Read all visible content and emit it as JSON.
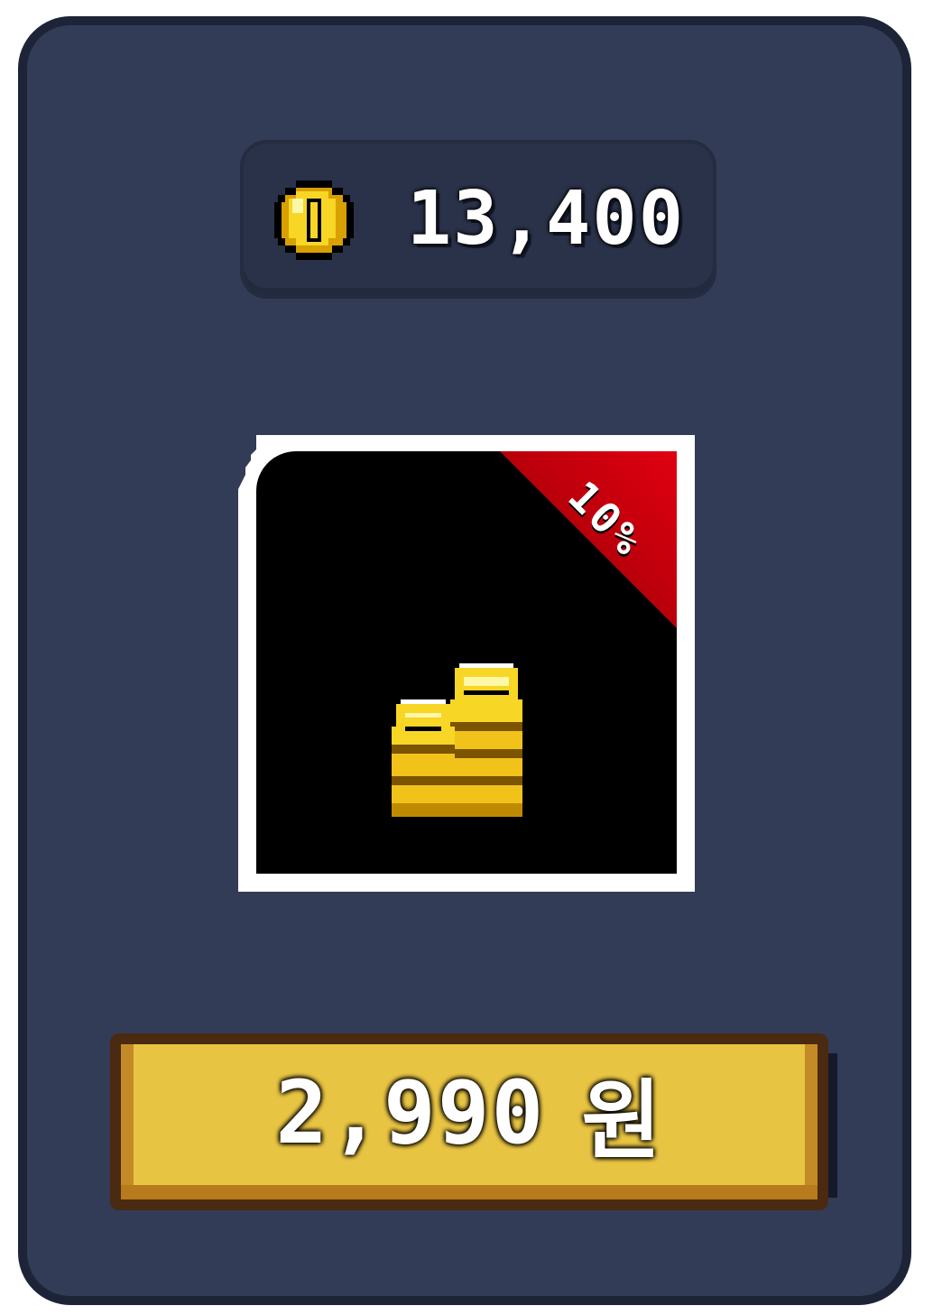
{
  "balance": {
    "icon": "coin-icon",
    "amount": "13,400"
  },
  "product": {
    "image": "gold-coin-stack-icon",
    "discount_badge": "10%",
    "badge_color": "#d00010",
    "frame_color": "#ffffff"
  },
  "purchase": {
    "price": "2,990",
    "currency": "원",
    "button_color": "#e8c443"
  },
  "colors": {
    "panel": "#323c56",
    "panel_border": "#1e2438",
    "coin_gold": "#f3d21e"
  }
}
